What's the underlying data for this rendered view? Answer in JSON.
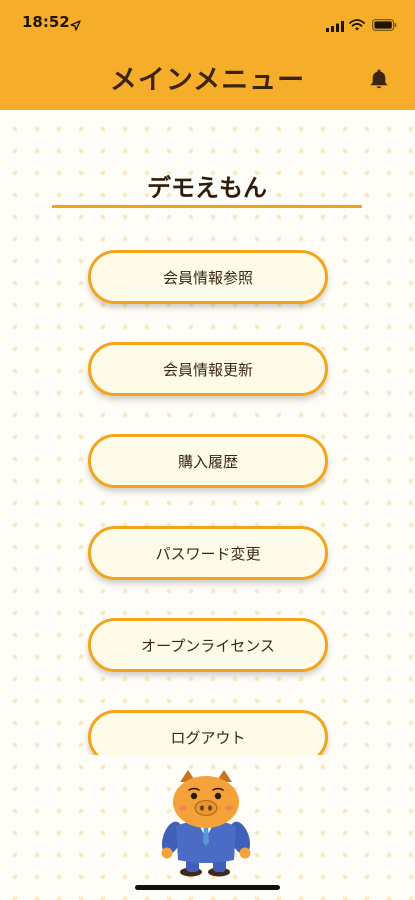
{
  "status_bar": {
    "time": "18:52"
  },
  "header": {
    "title": "メインメニュー"
  },
  "user": {
    "name": "デモえもん"
  },
  "menu": {
    "items": [
      {
        "label": "会員情報参照"
      },
      {
        "label": "会員情報更新"
      },
      {
        "label": "購入履歴"
      },
      {
        "label": "パスワード変更"
      },
      {
        "label": "オープンライセンス"
      },
      {
        "label": "ログアウト"
      }
    ]
  },
  "colors": {
    "accent": "#f6ae2a",
    "button_border": "#f2a51c",
    "button_fill": "#fffbe9",
    "background": "#fffdf7"
  },
  "icons": [
    "location-arrow-icon",
    "signal-icon",
    "wifi-icon",
    "battery-icon",
    "bell-icon"
  ]
}
